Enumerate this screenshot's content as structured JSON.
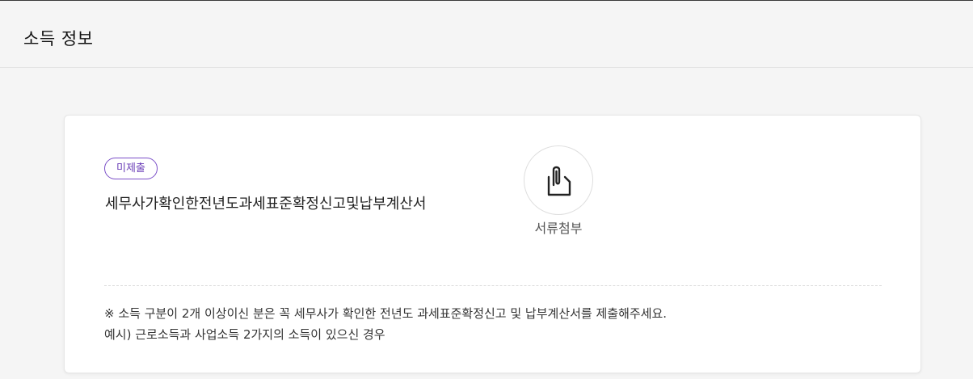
{
  "section": {
    "title": "소득 정보"
  },
  "document": {
    "status_badge": "미제출",
    "title": "세무사가확인한전년도과세표준확정신고및납부계산서"
  },
  "attach": {
    "label": "서류첨부",
    "icon": "paperclip-document-icon"
  },
  "notice": {
    "line1": "※ 소득 구분이 2개 이상이신 분은 꼭 세무사가 확인한 전년도 과세표준확정신고 및 납부계산서를 제출해주세요.",
    "line2": "예시) 근로소득과 사업소득 2가지의 소득이 있으신 경우"
  },
  "colors": {
    "badge_accent": "#7b4fc8",
    "page_background": "#f5f5f5",
    "card_background": "#ffffff"
  }
}
